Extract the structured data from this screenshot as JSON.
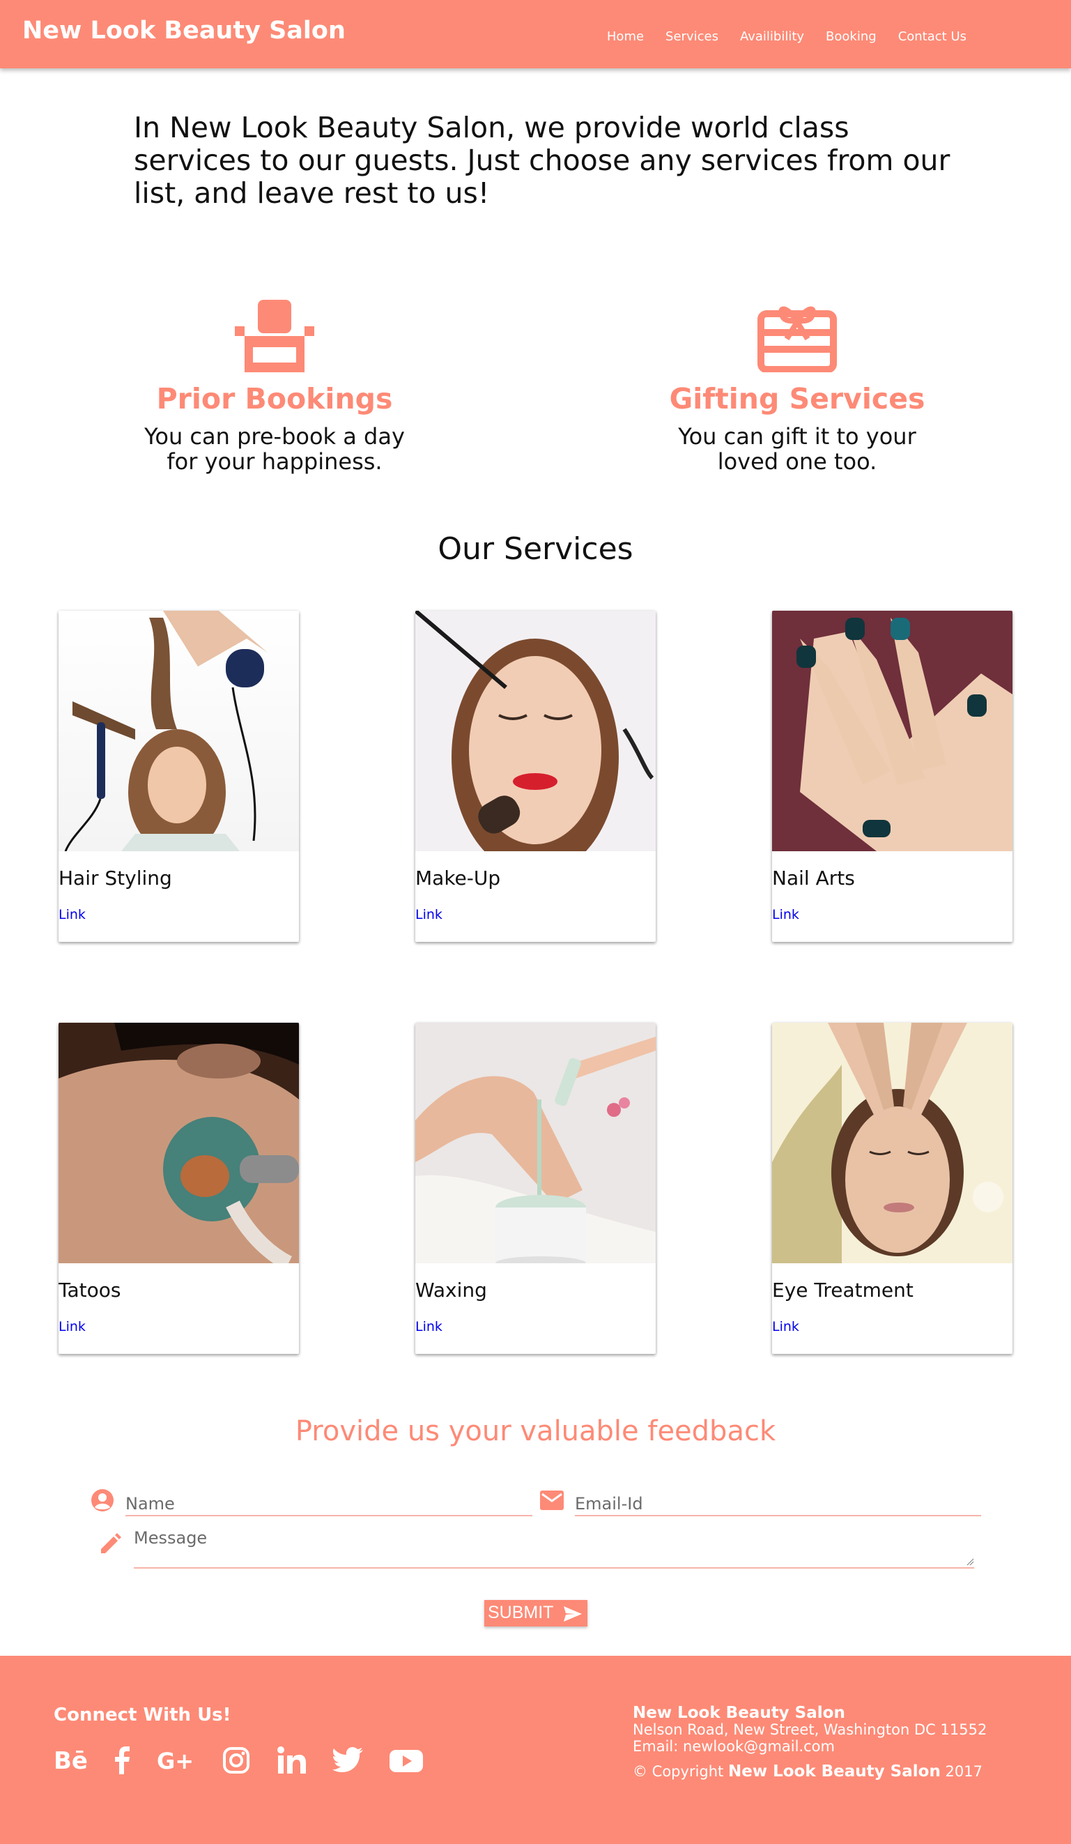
{
  "nav": {
    "brand": "New Look Beauty Salon",
    "links": [
      "Home",
      "Services",
      "Availibility",
      "Booking",
      "Contact Us"
    ]
  },
  "intro": "In New Look Beauty Salon, we provide world class services to our guests. Just choose any services from our list, and leave rest to us!",
  "features": [
    {
      "icon": "seat-icon",
      "title": "Prior Bookings",
      "text": "You can pre-book a day for your happiness."
    },
    {
      "icon": "gift-card-icon",
      "title": "Gifting Services",
      "text": "You can gift it to your loved one too."
    }
  ],
  "services": {
    "title": "Our Services",
    "cards": [
      {
        "title": "Hair Styling",
        "link": "Link"
      },
      {
        "title": "Make-Up",
        "link": "Link"
      },
      {
        "title": "Nail Arts",
        "link": "Link"
      },
      {
        "title": "Tatoos",
        "link": "Link"
      },
      {
        "title": "Waxing",
        "link": "Link"
      },
      {
        "title": "Eye Treatment",
        "link": "Link"
      }
    ]
  },
  "feedback": {
    "title": "Provide us your valuable feedback",
    "name_placeholder": "Name",
    "email_placeholder": "Email-Id",
    "message_placeholder": "Message",
    "submit_label": "SUBMIT"
  },
  "footer": {
    "connect": "Connect With Us!",
    "social_icons": [
      "behance-icon",
      "facebook-icon",
      "google-plus-icon",
      "instagram-icon",
      "linkedin-icon",
      "twitter-icon",
      "youtube-icon"
    ],
    "company": "New Look Beauty Salon",
    "address": "Nelson Road, New Street, Washington DC 11552",
    "email": "Email: newlook@gmail.com",
    "copyright_prefix": "© Copyright",
    "copyright_name": "New Look Beauty Salon",
    "copyright_year": "2017"
  },
  "colors": {
    "accent": "#fd8a76",
    "link": "#0000ee"
  }
}
